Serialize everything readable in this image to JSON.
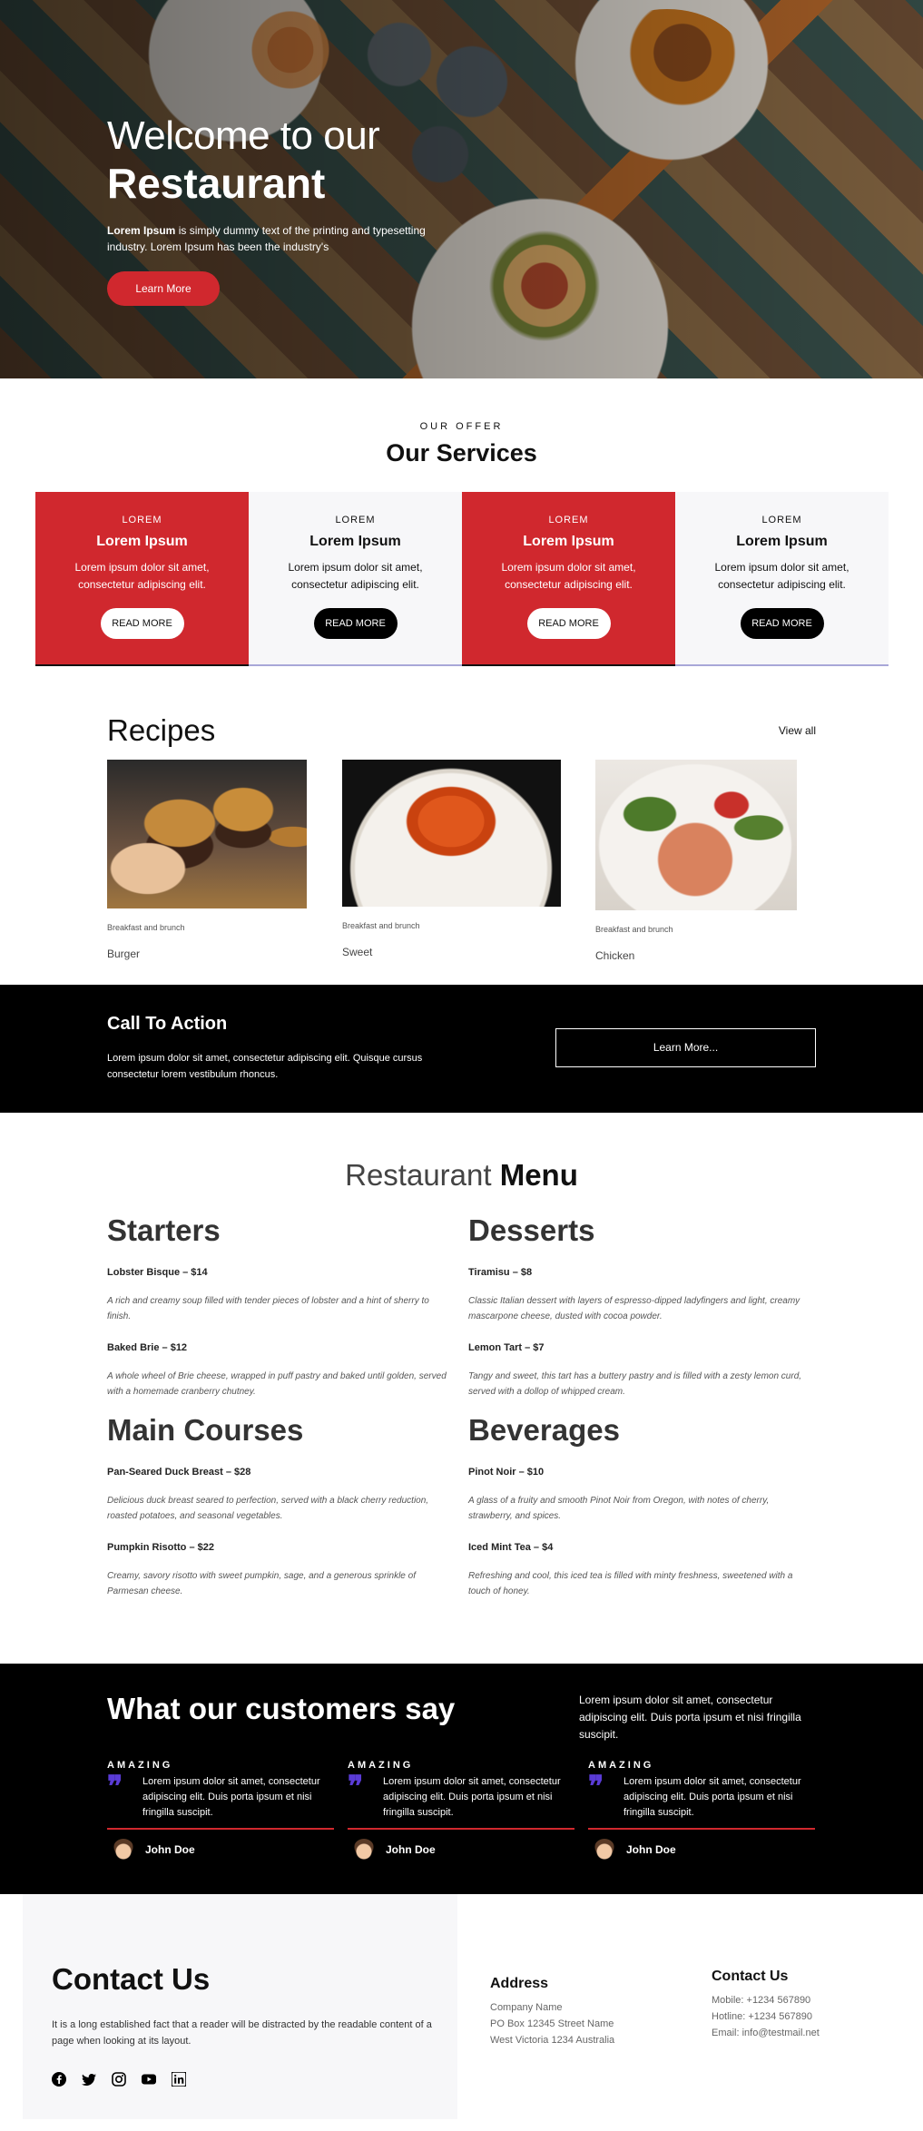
{
  "hero": {
    "line1": "Welcome to our",
    "line2": "Restaurant",
    "text_bold": "Lorem Ipsum",
    "text_rest": " is simply dummy text of the printing and typesetting industry. Lorem Ipsum has been the industry's",
    "button": "Learn More"
  },
  "services": {
    "eyebrow": "OUR OFFER",
    "title": "Our Services",
    "cards": [
      {
        "kicker": "LOREM",
        "title": "Lorem Ipsum",
        "desc": "Lorem ipsum dolor sit amet, consectetur adipiscing elit.",
        "button": "READ MORE"
      },
      {
        "kicker": "LOREM",
        "title": "Lorem Ipsum",
        "desc": "Lorem ipsum dolor sit amet, consectetur adipiscing elit.",
        "button": "READ MORE"
      },
      {
        "kicker": "LOREM",
        "title": "Lorem Ipsum",
        "desc": "Lorem ipsum dolor sit amet, consectetur adipiscing elit.",
        "button": "READ MORE"
      },
      {
        "kicker": "LOREM",
        "title": "Lorem Ipsum",
        "desc": "Lorem ipsum dolor sit amet, consectetur adipiscing elit.",
        "button": "READ MORE"
      }
    ]
  },
  "recipes": {
    "title": "Recipes",
    "view_all": "View all",
    "items": [
      {
        "category": "Breakfast and brunch",
        "name": "Burger"
      },
      {
        "category": "Breakfast and brunch",
        "name": "Sweet"
      },
      {
        "category": "Breakfast and brunch",
        "name": "Chicken"
      }
    ]
  },
  "cta": {
    "title": "Call To Action",
    "text": "Lorem ipsum dolor sit amet, consectetur adipiscing elit. Quisque cursus consectetur lorem vestibulum rhoncus.",
    "button": "Learn More..."
  },
  "menu": {
    "title_light": "Restaurant",
    "title_bold": "Menu",
    "starters": {
      "title": "Starters",
      "items": [
        {
          "name": "Lobster Bisque – $14",
          "desc": "A rich and creamy soup filled with tender pieces of lobster and a hint of sherry to finish."
        },
        {
          "name": "Baked Brie – $12",
          "desc": "A whole wheel of Brie cheese, wrapped in puff pastry and baked until golden, served with a homemade cranberry chutney."
        }
      ]
    },
    "mains": {
      "title": "Main Courses",
      "items": [
        {
          "name": "Pan-Seared Duck Breast – $28",
          "desc": "Delicious duck breast seared to perfection, served with a black cherry reduction, roasted potatoes, and seasonal vegetables."
        },
        {
          "name": "Pumpkin Risotto – $22",
          "desc": "Creamy, savory risotto with sweet pumpkin, sage, and a generous sprinkle of Parmesan cheese."
        }
      ]
    },
    "desserts": {
      "title": "Desserts",
      "items": [
        {
          "name": "Tiramisu – $8",
          "desc": "Classic Italian dessert with layers of espresso-dipped ladyfingers and light, creamy mascarpone cheese, dusted with cocoa powder."
        },
        {
          "name": "Lemon Tart – $7",
          "desc": "Tangy and sweet, this tart has a buttery pastry and is filled with a zesty lemon curd, served with a dollop of whipped cream."
        }
      ]
    },
    "beverages": {
      "title": "Beverages",
      "items": [
        {
          "name": "Pinot Noir – $10",
          "desc": "A glass of a fruity and smooth Pinot Noir from Oregon, with notes of cherry, strawberry, and spices."
        },
        {
          "name": "Iced Mint Tea – $4",
          "desc": "Refreshing and cool, this iced tea is filled with minty freshness, sweetened with a touch of honey."
        }
      ]
    }
  },
  "testimonials": {
    "title": "What our customers say",
    "intro": "Lorem ipsum dolor sit amet, consectetur adipiscing elit. Duis porta ipsum et nisi fringilla suscipit.",
    "items": [
      {
        "label": "AMAZING",
        "quote": "Lorem ipsum dolor sit amet, consectetur adipiscing elit. Duis porta ipsum et nisi fringilla suscipit.",
        "name": "John Doe"
      },
      {
        "label": "AMAZING",
        "quote": "Lorem ipsum dolor sit amet, consectetur adipiscing elit. Duis porta ipsum et nisi fringilla suscipit.",
        "name": "John Doe"
      },
      {
        "label": "AMAZING",
        "quote": "Lorem ipsum dolor sit amet, consectetur adipiscing elit. Duis porta ipsum et nisi fringilla suscipit.",
        "name": "John Doe"
      }
    ]
  },
  "contact": {
    "title": "Contact Us",
    "text": "It is a long established fact that a reader will be distracted by the readable content of a page when looking at its layout.",
    "socials": [
      "facebook-icon",
      "twitter-icon",
      "instagram-icon",
      "youtube-icon",
      "linkedin-icon"
    ],
    "address": {
      "title": "Address",
      "lines": [
        "Company Name",
        "PO Box 12345 Street Name",
        "West Victoria 1234 Australia"
      ]
    },
    "details": {
      "title": "Contact Us",
      "lines": [
        "Mobile: +1234 567890",
        "Hotline: +1234 567890",
        "Email: info@testmail.net"
      ]
    }
  },
  "colors": {
    "accent": "#d0282e",
    "dark": "#000000",
    "quote": "#5a3bd6",
    "card_light": "#f7f7f9"
  }
}
